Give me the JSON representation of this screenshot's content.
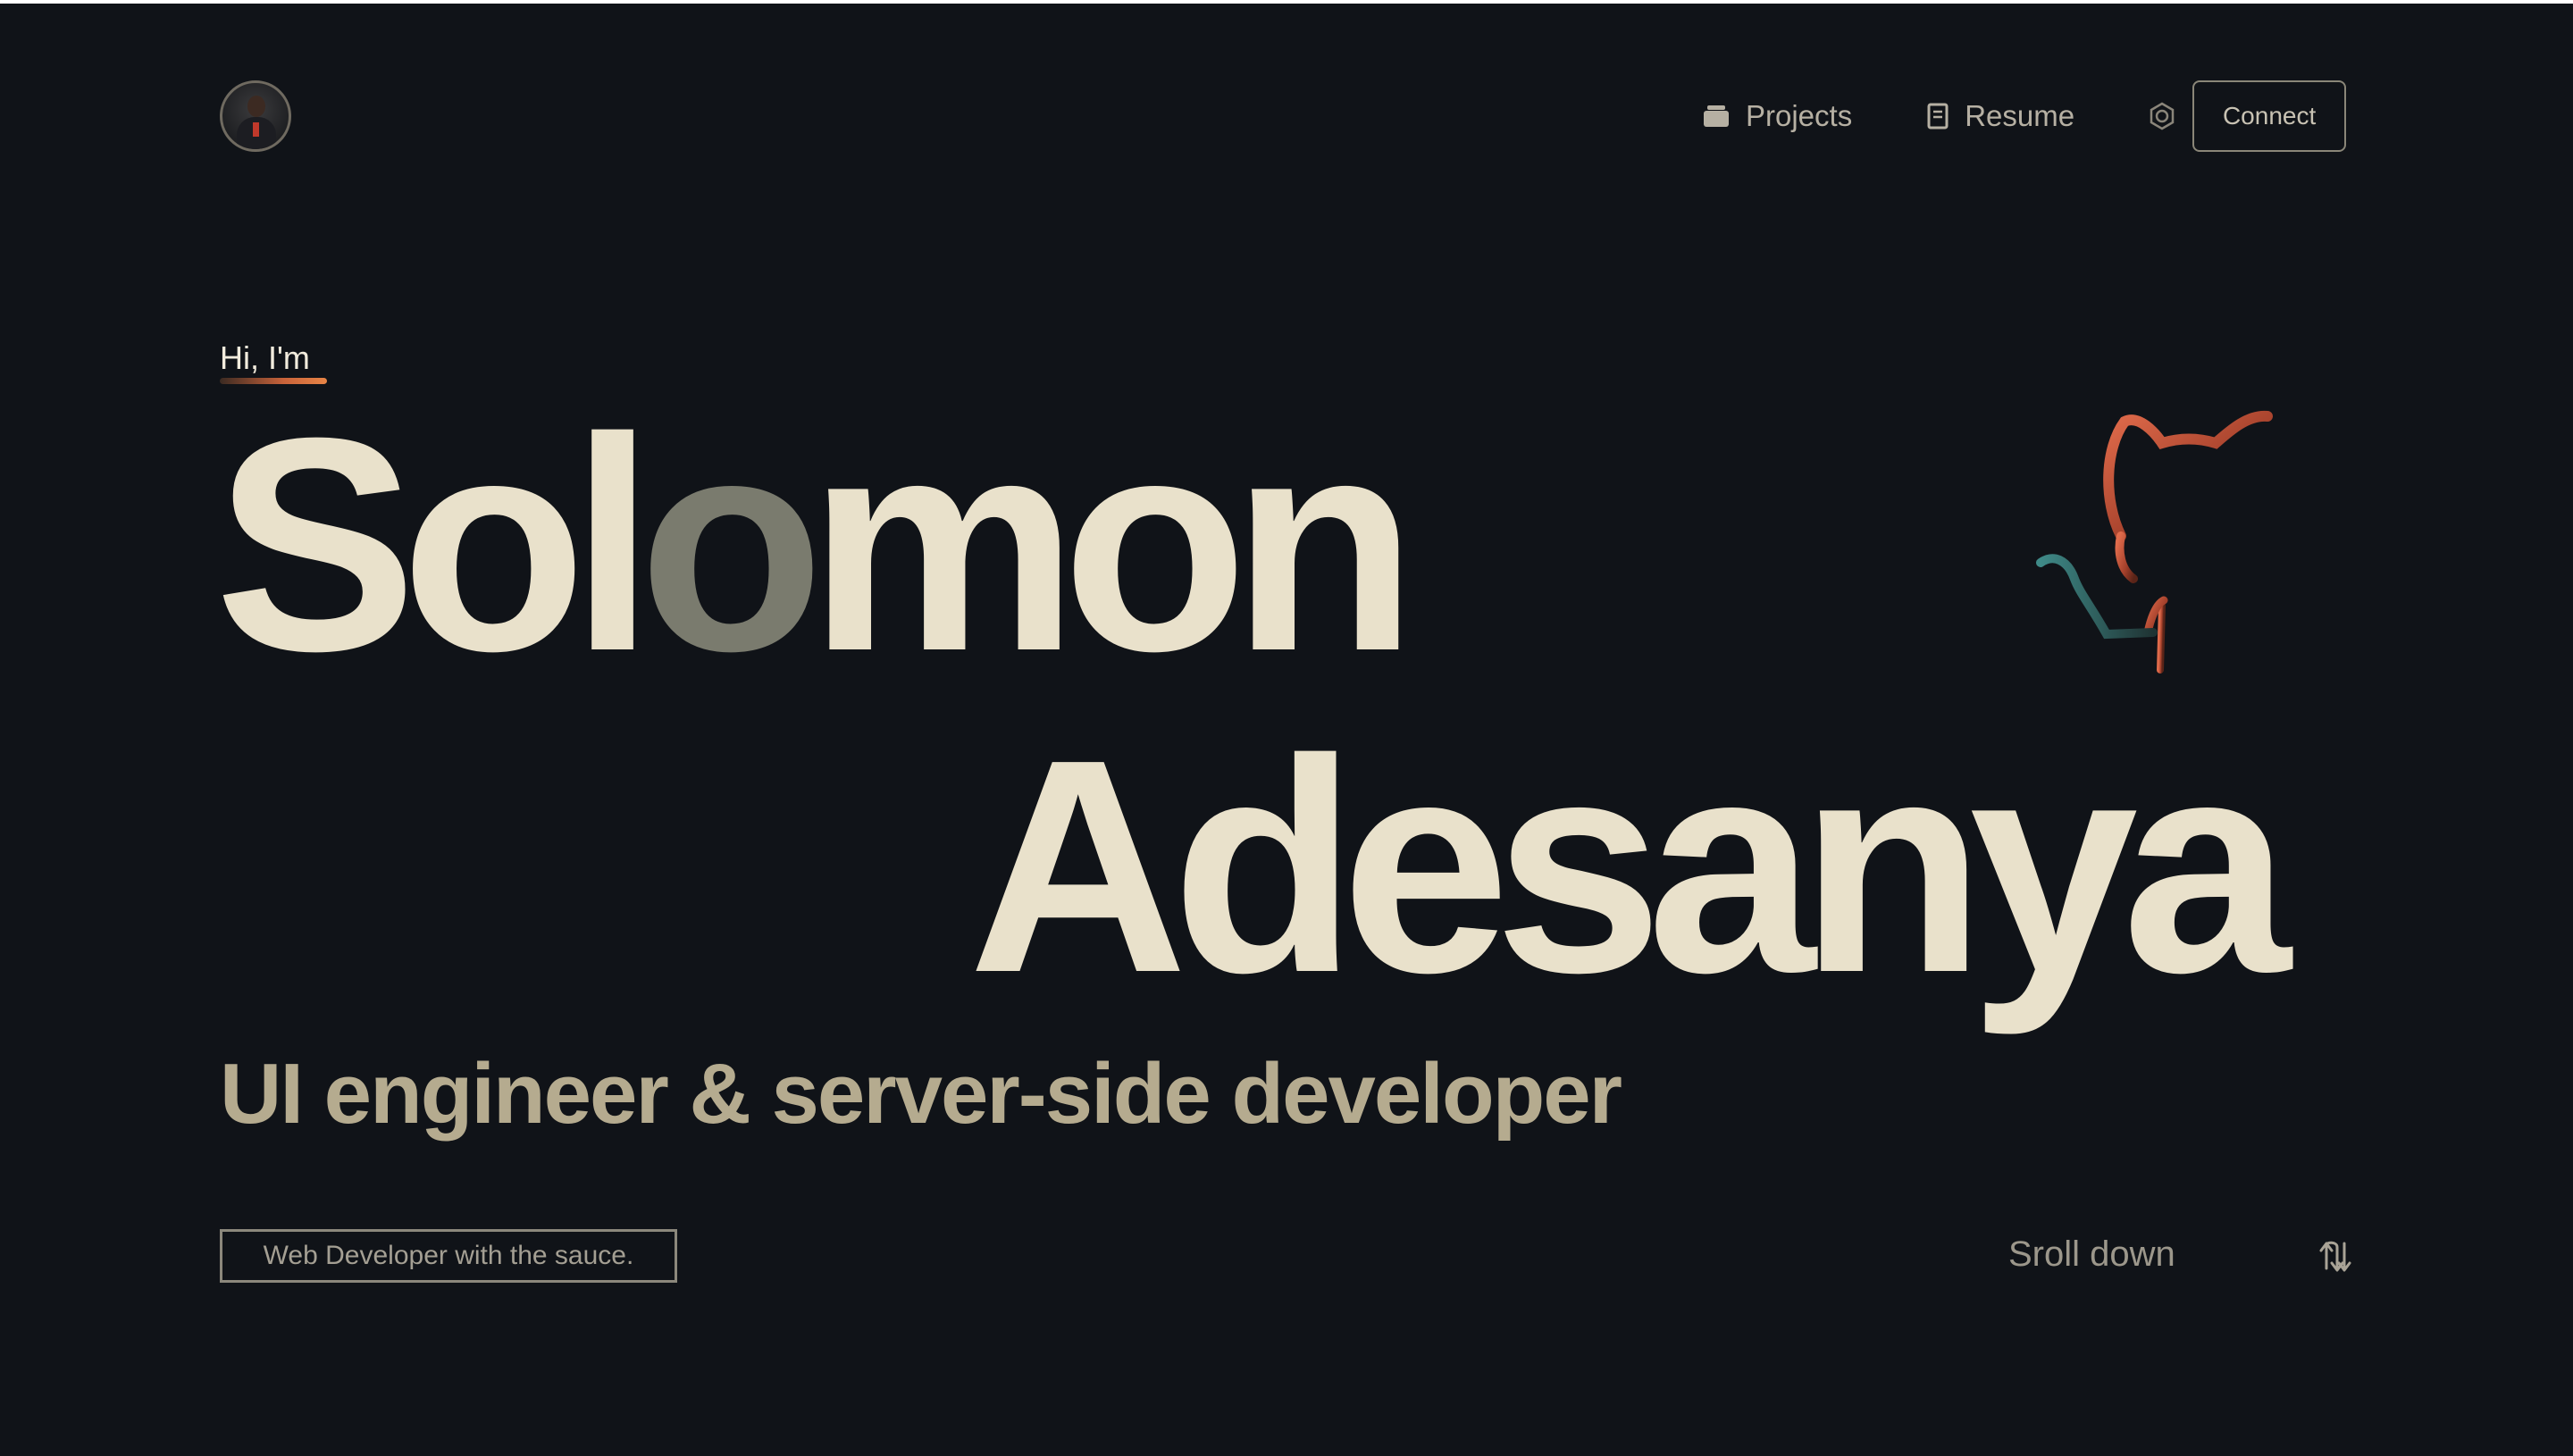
{
  "nav": {
    "projects_label": "Projects",
    "resume_label": "Resume",
    "connect_label": "Connect"
  },
  "hero": {
    "greeting": "Hi, I'm",
    "first_name_part1": "Sol",
    "first_name_highlight": "o",
    "first_name_part2": "mon",
    "last_name": "Adesanya",
    "tagline": "UI engineer & server-side developer",
    "badge": "Web Developer with the sauce.",
    "scroll_label": "Sroll down"
  },
  "icons": {
    "avatar": "profile-photo",
    "projects": "briefcase-icon",
    "resume": "document-icon",
    "settings": "gear-icon",
    "hero_illustration": "octocat-icon",
    "scroll": "scroll-arrows-icon"
  },
  "colors": {
    "background": "#101318",
    "name": "#e9e1cb",
    "name_highlight": "#7a7b6e",
    "tagline": "#b5ab8f",
    "accent": "#e88546"
  }
}
